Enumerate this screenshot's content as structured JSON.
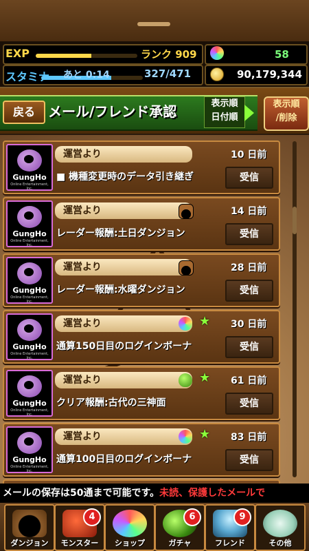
{
  "status": {
    "exp_label": "EXP",
    "exp_progress": 0.55,
    "rank_text": "ランク 909",
    "stamina_label": "スタミナ",
    "stamina_remaining": "あと 0:14",
    "stamina_value": "327/471",
    "stamina_progress": 0.69,
    "gem_count": "58",
    "coin_count": "90,179,344",
    "gem_icon": "rainbow-stone-icon",
    "coin_icon": "coin-icon"
  },
  "header": {
    "back_label": "戻る",
    "title": "メール/フレンド承認",
    "sort_box_line1": "表示順",
    "sort_box_line2": "日付順",
    "sort_button_line1": "表示順",
    "sort_button_line2": "/削除"
  },
  "mails": [
    {
      "sender": "運営より",
      "date": "10 日前",
      "subject": "■ 機種変更時のデータ引き継ぎ",
      "receive": "受信",
      "attachment": "none",
      "starred": false
    },
    {
      "sender": "運営より",
      "date": "14 日前",
      "subject": "レーダー報酬:土日ダンジョン",
      "receive": "受信",
      "attachment": "dungeon",
      "starred": false
    },
    {
      "sender": "運営より",
      "date": "28 日前",
      "subject": "レーダー報酬:水曜ダンジョン",
      "receive": "受信",
      "attachment": "dungeon",
      "starred": false
    },
    {
      "sender": "運営より",
      "date": "30 日前",
      "subject": "通算150日目のログインボーナ",
      "receive": "受信",
      "attachment": "rainbow",
      "starred": true
    },
    {
      "sender": "運営より",
      "date": "61 日前",
      "subject": "クリア報酬:古代の三神面",
      "receive": "受信",
      "attachment": "egg",
      "starred": true
    },
    {
      "sender": "運営より",
      "date": "83 日前",
      "subject": "通算100日目のログインボーナ",
      "receive": "受信",
      "attachment": "rainbow",
      "starred": true
    }
  ],
  "avatar": {
    "logo": "GungHo",
    "sub": "Online Entertainment, Inc."
  },
  "notice": {
    "white": "メールの保存は50通まで可能です。",
    "red": "未読、保護したメールで"
  },
  "tabs": [
    {
      "label": "ダンジョン",
      "badge": ""
    },
    {
      "label": "モンスター",
      "badge": "4"
    },
    {
      "label": "ショップ",
      "badge": ""
    },
    {
      "label": "ガチャ",
      "badge": "6"
    },
    {
      "label": "フレンド",
      "badge": "9"
    },
    {
      "label": "その他",
      "badge": ""
    }
  ],
  "colors": {
    "accent_green": "#2c7a1e",
    "badge_red": "#e02020",
    "star_green": "#8aff3a",
    "avatar_border": "#d86ad8"
  }
}
